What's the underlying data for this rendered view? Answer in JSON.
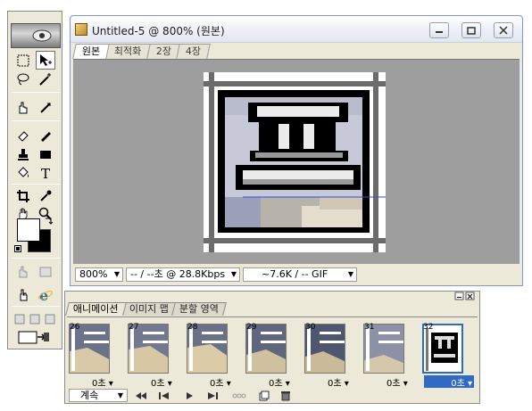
{
  "document": {
    "title": "Untitled-5 @ 800% (원본)",
    "tabs": [
      "원본",
      "최적화",
      "2장",
      "4장"
    ],
    "status": {
      "zoom": "800%",
      "download_time": "-- / --초 @ 28.8Kbps",
      "file_size": "~7.6K / -- GIF"
    }
  },
  "animation_panel": {
    "tabs": [
      "애니메이션",
      "이미지 맵",
      "분할 영역"
    ],
    "frames": [
      {
        "number": "26",
        "delay": "0초"
      },
      {
        "number": "27",
        "delay": "0초"
      },
      {
        "number": "28",
        "delay": "0초"
      },
      {
        "number": "29",
        "delay": "0초"
      },
      {
        "number": "30",
        "delay": "0초"
      },
      {
        "number": "31",
        "delay": "0초"
      },
      {
        "number": "32",
        "delay": "0초",
        "selected": true
      }
    ],
    "loop_option": "계속"
  },
  "colors": {
    "selection_blue": "#316ac5",
    "canvas_gray": "#9e9e9e",
    "panel_bg": "#ece9d8"
  }
}
